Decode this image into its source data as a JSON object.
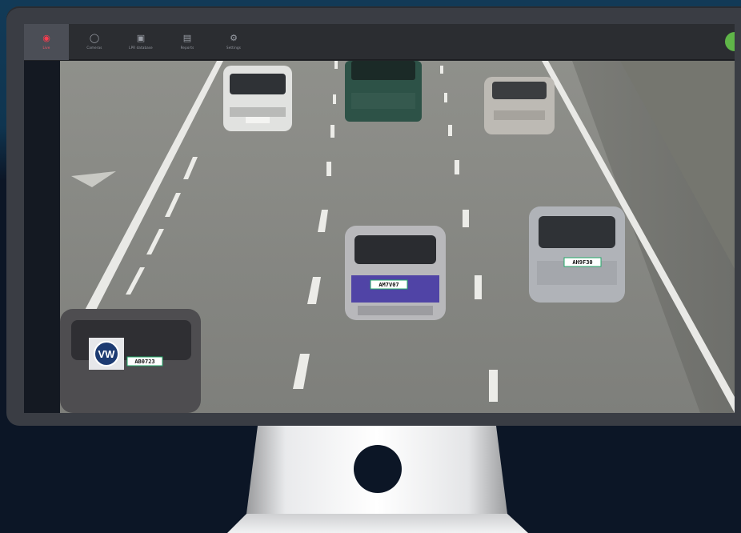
{
  "toolbar": {
    "items": [
      {
        "label": "Live",
        "icon": "camera-icon",
        "active": true
      },
      {
        "label": "Cameras",
        "icon": "camera-outline-icon",
        "active": false
      },
      {
        "label": "LPR database",
        "icon": "database-icon",
        "active": false
      },
      {
        "label": "Reports",
        "icon": "report-icon",
        "active": false
      },
      {
        "label": "Settings",
        "icon": "gear-icon",
        "active": false
      }
    ]
  },
  "feed": {
    "plates": [
      "AM7V07",
      "AH9F30",
      "AB0723"
    ],
    "brand": "VW"
  },
  "colors": {
    "background": "#0c1626",
    "bezel": "#3a3d44",
    "accent": "#ff3b4e",
    "status": "#5fb548",
    "detection": "#6b3df0"
  }
}
